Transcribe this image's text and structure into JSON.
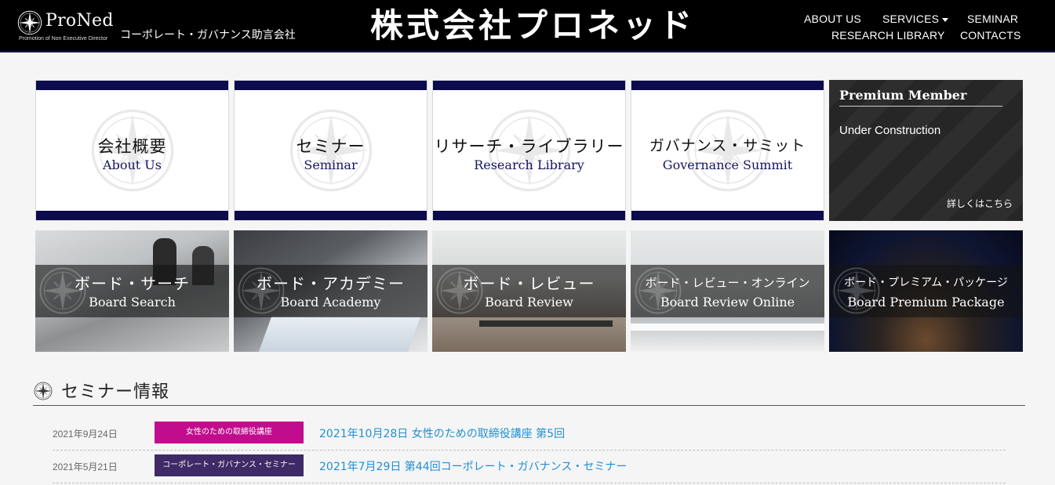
{
  "header": {
    "logo_name": "ProNed",
    "logo_sub": "Promotion of Non Executive Director",
    "tagline": "コーポレート・ガバナンス助言会社",
    "company_name": "株式会社プロネッド",
    "nav": {
      "about": "ABOUT US",
      "services": "SERVICES",
      "seminar": "SEMINAR",
      "research": "RESEARCH LIBRARY",
      "contacts": "CONTACTS"
    }
  },
  "tiles": [
    {
      "jp": "会社概要",
      "en": "About Us"
    },
    {
      "jp": "セミナー",
      "en": "Seminar"
    },
    {
      "jp": "リサーチ・ライブラリー",
      "en": "Research Library"
    },
    {
      "jp": "ガバナンス・サミット",
      "en": "Governance Summit"
    }
  ],
  "premium": {
    "title": "Premium Member",
    "status": "Under Construction",
    "link": "詳しくはこちら"
  },
  "services": [
    {
      "jp": "ボード・サーチ",
      "en": "Board Search"
    },
    {
      "jp": "ボード・アカデミー",
      "en": "Board Academy"
    },
    {
      "jp": "ボード・レビュー",
      "en": "Board Review"
    },
    {
      "jp": "ボード・レビュー・オンライン",
      "en": "Board Review Online"
    },
    {
      "jp": "ボード・プレミアム・パッケージ",
      "en": "Board Premium Package"
    }
  ],
  "seminar_section": {
    "title": "セミナー情報",
    "items": [
      {
        "date": "2021年9月24日",
        "badge": "女性のための取締役講座",
        "badge_color": "#c20c8e",
        "title": "2021年10月28日 女性のための取締役講座 第5回"
      },
      {
        "date": "2021年5月21日",
        "badge": "コーポレート・ガバナンス・セミナー",
        "badge_color": "#3e2a66",
        "title": "2021年7月29日 第44回コーポレート・ガバナンス・セミナー"
      }
    ]
  },
  "colors": {
    "header_bg": "#000000",
    "tile_band": "#0c0b4e",
    "link": "#1f8fd2"
  }
}
